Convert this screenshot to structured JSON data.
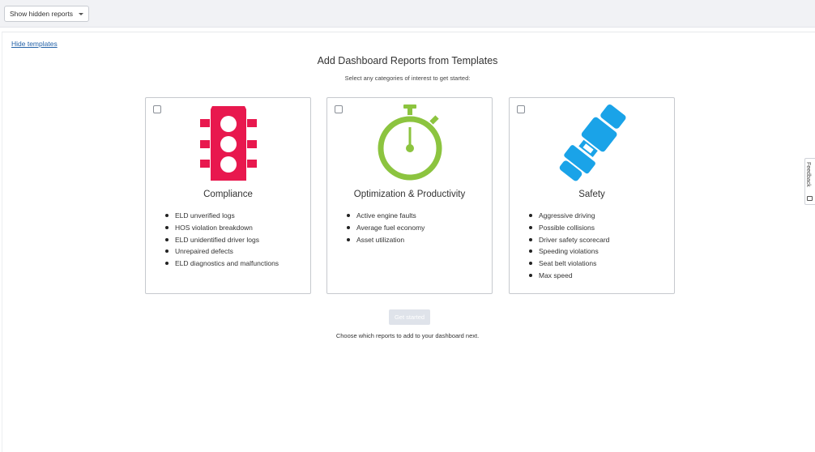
{
  "toolbar": {
    "show_hidden_label": "Show hidden reports"
  },
  "links": {
    "hide_templates": "Hide templates"
  },
  "header": {
    "title": "Add Dashboard Reports from Templates",
    "subtitle": "Select any categories of interest to get started:"
  },
  "cards": [
    {
      "title": "Compliance",
      "icon": "traffic-light-icon",
      "color": "#e8184e",
      "items": [
        "ELD unverified logs",
        "HOS violation breakdown",
        "ELD unidentified driver logs",
        "Unrepaired defects",
        "ELD diagnostics and malfunctions"
      ]
    },
    {
      "title": "Optimization & Productivity",
      "icon": "stopwatch-icon",
      "color": "#8cc43f",
      "items": [
        "Active engine faults",
        "Average fuel economy",
        "Asset utilization"
      ]
    },
    {
      "title": "Safety",
      "icon": "seatbelt-icon",
      "color": "#1aa3e8",
      "items": [
        "Aggressive driving",
        "Possible collisions",
        "Driver safety scorecard",
        "Speeding violations",
        "Seat belt violations",
        "Max speed"
      ]
    }
  ],
  "footer": {
    "get_started": "Get started",
    "note": "Choose which reports to add to your dashboard next."
  },
  "feedback": {
    "label": "Feedback"
  }
}
